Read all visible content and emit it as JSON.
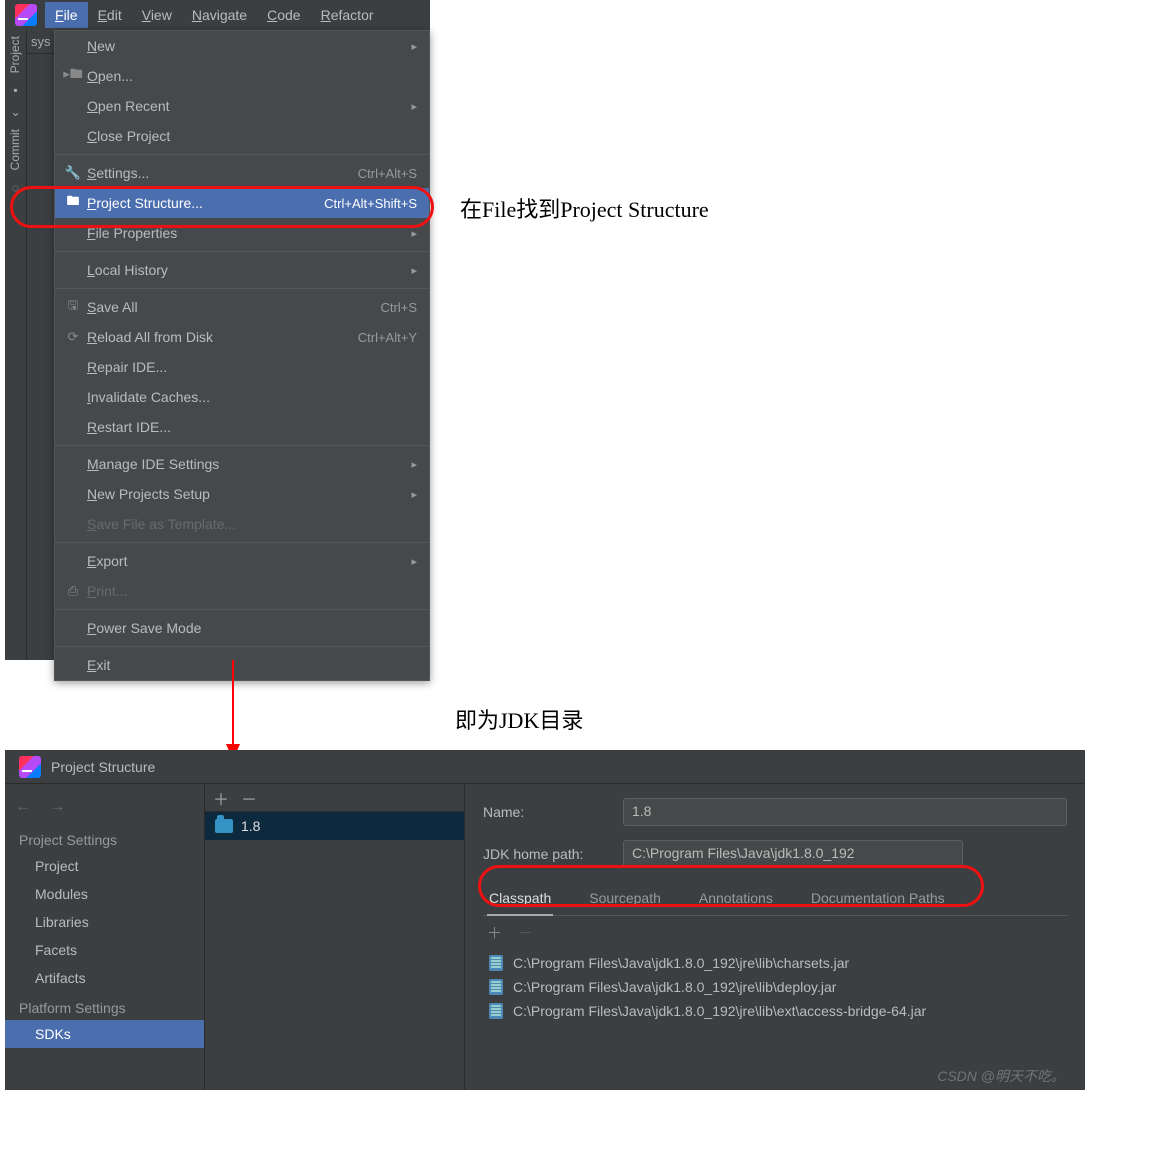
{
  "menubar": [
    "File",
    "Edit",
    "View",
    "Navigate",
    "Code",
    "Refactor"
  ],
  "menubar_active_index": 0,
  "sidebar_truncated": "sys",
  "left_tabs": [
    "Project",
    "Commit"
  ],
  "file_menu": [
    {
      "type": "item",
      "icon": "",
      "label": "New",
      "shortcut": "",
      "arrow": true
    },
    {
      "type": "item",
      "icon": "folder",
      "label": "Open...",
      "shortcut": "",
      "arrow": false
    },
    {
      "type": "item",
      "icon": "",
      "label": "Open Recent",
      "shortcut": "",
      "arrow": true
    },
    {
      "type": "item",
      "icon": "",
      "label": "Close Project",
      "shortcut": "",
      "arrow": false
    },
    {
      "type": "sep"
    },
    {
      "type": "item",
      "icon": "wrench",
      "label": "Settings...",
      "shortcut": "Ctrl+Alt+S",
      "arrow": false
    },
    {
      "type": "item",
      "icon": "folder-gear",
      "label": "Project Structure...",
      "shortcut": "Ctrl+Alt+Shift+S",
      "arrow": false,
      "highlight": true
    },
    {
      "type": "item",
      "icon": "",
      "label": "File Properties",
      "shortcut": "",
      "arrow": true
    },
    {
      "type": "sep"
    },
    {
      "type": "item",
      "icon": "",
      "label": "Local History",
      "shortcut": "",
      "arrow": true
    },
    {
      "type": "sep"
    },
    {
      "type": "item",
      "icon": "disk",
      "label": "Save All",
      "shortcut": "Ctrl+S",
      "arrow": false
    },
    {
      "type": "item",
      "icon": "reload",
      "label": "Reload All from Disk",
      "shortcut": "Ctrl+Alt+Y",
      "arrow": false
    },
    {
      "type": "item",
      "icon": "",
      "label": "Repair IDE...",
      "shortcut": "",
      "arrow": false
    },
    {
      "type": "item",
      "icon": "",
      "label": "Invalidate Caches...",
      "shortcut": "",
      "arrow": false
    },
    {
      "type": "item",
      "icon": "",
      "label": "Restart IDE...",
      "shortcut": "",
      "arrow": false
    },
    {
      "type": "sep"
    },
    {
      "type": "item",
      "icon": "",
      "label": "Manage IDE Settings",
      "shortcut": "",
      "arrow": true
    },
    {
      "type": "item",
      "icon": "",
      "label": "New Projects Setup",
      "shortcut": "",
      "arrow": true
    },
    {
      "type": "item",
      "icon": "",
      "label": "Save File as Template...",
      "shortcut": "",
      "arrow": false,
      "disabled": true
    },
    {
      "type": "sep"
    },
    {
      "type": "item",
      "icon": "",
      "label": "Export",
      "shortcut": "",
      "arrow": true
    },
    {
      "type": "item",
      "icon": "print",
      "label": "Print...",
      "shortcut": "",
      "arrow": false,
      "disabled": true
    },
    {
      "type": "sep"
    },
    {
      "type": "item",
      "icon": "",
      "label": "Power Save Mode",
      "shortcut": "",
      "arrow": false
    },
    {
      "type": "sep"
    },
    {
      "type": "item",
      "icon": "",
      "label": "Exit",
      "shortcut": "",
      "arrow": false
    }
  ],
  "annotation_top": "在File找到Project Structure",
  "annotation_mid": "即为JDK目录",
  "ps": {
    "title": "Project Structure",
    "settings_head": "Project Settings",
    "settings_items": [
      "Project",
      "Modules",
      "Libraries",
      "Facets",
      "Artifacts"
    ],
    "platform_head": "Platform Settings",
    "platform_items": [
      "SDKs"
    ],
    "platform_active": "SDKs",
    "sdk_list": [
      "1.8"
    ],
    "form_name_label": "Name:",
    "form_name_value": "1.8",
    "form_path_label": "JDK home path:",
    "form_path_value": "C:\\Program Files\\Java\\jdk1.8.0_192",
    "tabs": [
      "Classpath",
      "Sourcepath",
      "Annotations",
      "Documentation Paths"
    ],
    "tab_active": "Classpath",
    "classpath": [
      "C:\\Program Files\\Java\\jdk1.8.0_192\\jre\\lib\\charsets.jar",
      "C:\\Program Files\\Java\\jdk1.8.0_192\\jre\\lib\\deploy.jar",
      "C:\\Program Files\\Java\\jdk1.8.0_192\\jre\\lib\\ext\\access-bridge-64.jar"
    ]
  },
  "watermark": "CSDN @明天不吃。"
}
